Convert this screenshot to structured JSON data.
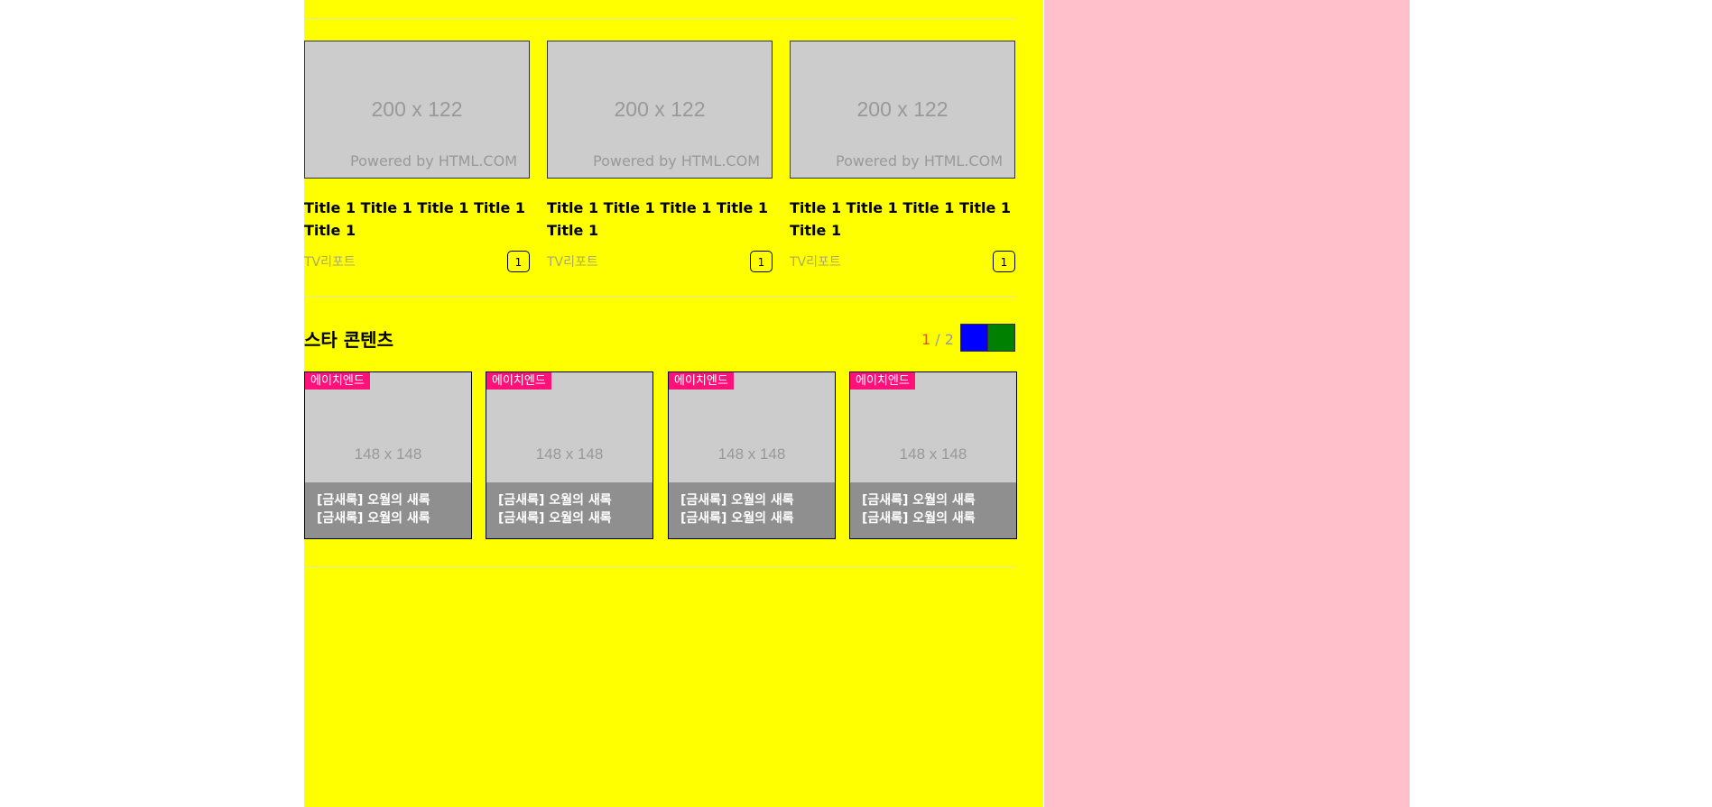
{
  "cards": [
    {
      "placeholder": "200 x 122",
      "powered": "Powered by HTML.COM",
      "title": "Title 1 Title 1 Title 1 Title 1 Title 1",
      "category": "TV리포트",
      "count": "1"
    },
    {
      "placeholder": "200 x 122",
      "powered": "Powered by HTML.COM",
      "title": "Title 1 Title 1 Title 1 Title 1 Title 1",
      "category": "TV리포트",
      "count": "1"
    },
    {
      "placeholder": "200 x 122",
      "powered": "Powered by HTML.COM",
      "title": "Title 1 Title 1 Title 1 Title 1 Title 1",
      "category": "TV리포트",
      "count": "1"
    }
  ],
  "star_section": {
    "heading": "스타 콘텐츠",
    "pager": {
      "current": "1",
      "separator": " / ",
      "total": "2"
    },
    "colors": {
      "prev_button": "#0000ff",
      "next_button": "#008000",
      "badge": "#ff1179"
    },
    "items": [
      {
        "badge": "에이치엔드",
        "placeholder": "148 x 148",
        "caption_line1": "[금새록] 오월의 새록",
        "caption_line2": "[금새록] 오월의 새록"
      },
      {
        "badge": "에이치엔드",
        "placeholder": "148 x 148",
        "caption_line1": "[금새록] 오월의 새록",
        "caption_line2": "[금새록] 오월의 새록"
      },
      {
        "badge": "에이치엔드",
        "placeholder": "148 x 148",
        "caption_line1": "[금새록] 오월의 새록",
        "caption_line2": "[금새록] 오월의 새록"
      },
      {
        "badge": "에이치엔드",
        "placeholder": "148 x 148",
        "caption_line1": "[금새록] 오월의 새록",
        "caption_line2": "[금새록] 오월의 새록"
      }
    ]
  },
  "colors": {
    "main_background": "#ffff00",
    "side_background": "#ffc0cb"
  }
}
